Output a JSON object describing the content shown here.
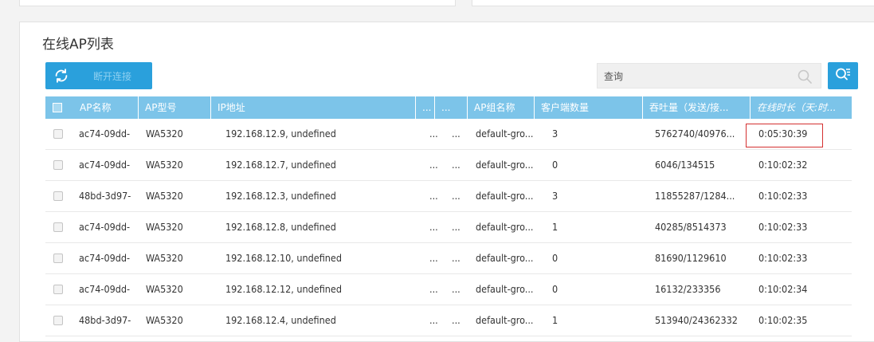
{
  "panel": {
    "title": "在线AP列表"
  },
  "toolbar": {
    "disconnect_label": "断开连接"
  },
  "search": {
    "placeholder": "查询"
  },
  "table": {
    "headers": {
      "ap_name": "AP名称",
      "ap_model": "AP型号",
      "ip": "IP地址",
      "col_a": "...",
      "col_b": "...",
      "group": "AP组名称",
      "clients": "客户端数量",
      "throughput": "吞吐量（发送/接...",
      "online": "在线时长（天:时..."
    },
    "rows": [
      {
        "name": "ac74-09dd-",
        "model": "WA5320",
        "ip": "192.168.12.9, undefined",
        "a": "...",
        "b": "...",
        "group": "default-gro...",
        "clients": "3",
        "throughput": "5762740/40976...",
        "online": "0:05:30:39"
      },
      {
        "name": "ac74-09dd-",
        "model": "WA5320",
        "ip": "192.168.12.7, undefined",
        "a": "...",
        "b": "...",
        "group": "default-gro...",
        "clients": "0",
        "throughput": "6046/134515",
        "online": "0:10:02:32"
      },
      {
        "name": "48bd-3d97-",
        "model": "WA5320",
        "ip": "192.168.12.3, undefined",
        "a": "...",
        "b": "...",
        "group": "default-gro...",
        "clients": "3",
        "throughput": "11855287/1284...",
        "online": "0:10:02:33"
      },
      {
        "name": "ac74-09dd-",
        "model": "WA5320",
        "ip": "192.168.12.8, undefined",
        "a": "...",
        "b": "...",
        "group": "default-gro...",
        "clients": "1",
        "throughput": "40285/8514373",
        "online": "0:10:02:33"
      },
      {
        "name": "ac74-09dd-",
        "model": "WA5320",
        "ip": "192.168.12.10, undefined",
        "a": "...",
        "b": "...",
        "group": "default-gro...",
        "clients": "0",
        "throughput": "81690/1129610",
        "online": "0:10:02:33"
      },
      {
        "name": "ac74-09dd-",
        "model": "WA5320",
        "ip": "192.168.12.12, undefined",
        "a": "...",
        "b": "...",
        "group": "default-gro...",
        "clients": "0",
        "throughput": "16132/233356",
        "online": "0:10:02:34"
      },
      {
        "name": "48bd-3d97-",
        "model": "WA5320",
        "ip": "192.168.12.4, undefined",
        "a": "...",
        "b": "...",
        "group": "default-gro...",
        "clients": "1",
        "throughput": "513940/24362332",
        "online": "0:10:02:35"
      }
    ]
  },
  "colors": {
    "accent": "#2aa0dc",
    "header_bg": "#7cc4e9",
    "highlight": "#d43030"
  }
}
